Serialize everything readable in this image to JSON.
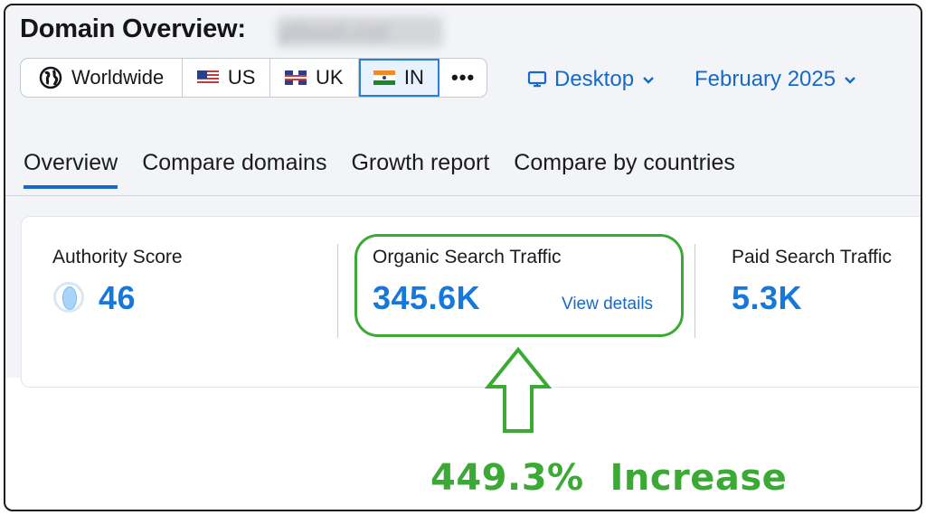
{
  "header": {
    "title": "Domain Overview:",
    "domain_obscured": "pbool.co/"
  },
  "database_selector": {
    "buttons": [
      {
        "label": "Worldwide",
        "icon": "globe-icon",
        "active": false
      },
      {
        "label": "US",
        "icon": "us-flag-icon",
        "active": false
      },
      {
        "label": "UK",
        "icon": "uk-flag-icon",
        "active": false
      },
      {
        "label": "IN",
        "icon": "india-flag-icon",
        "active": true
      }
    ],
    "more_icon": "more-dots-icon",
    "more_label": "•••"
  },
  "device": {
    "label": "Desktop",
    "icon": "monitor-icon"
  },
  "date": {
    "label": "February 2025"
  },
  "tabs": [
    {
      "label": "Overview",
      "active": true
    },
    {
      "label": "Compare domains",
      "active": false
    },
    {
      "label": "Growth report",
      "active": false
    },
    {
      "label": "Compare by countries",
      "active": false
    }
  ],
  "metrics": {
    "authority": {
      "label": "Authority Score",
      "value": "46"
    },
    "organic": {
      "label": "Organic Search Traffic",
      "value": "345.6K",
      "link": "View details"
    },
    "paid": {
      "label": "Paid Search Traffic",
      "value": "5.3K"
    }
  },
  "annotation": {
    "text": "449.3%  Increase",
    "color": "#3aaa35"
  },
  "colors": {
    "accent": "#1478dc",
    "link": "#1769c8",
    "annotation": "#3aaa35"
  }
}
